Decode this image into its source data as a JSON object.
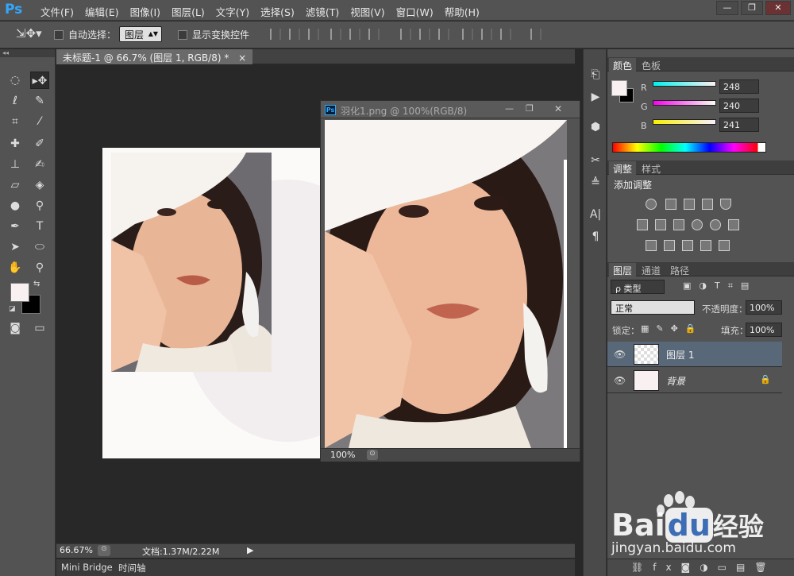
{
  "app": {
    "logo": "Ps"
  },
  "menu": [
    "文件(F)",
    "编辑(E)",
    "图像(I)",
    "图层(L)",
    "文字(Y)",
    "选择(S)",
    "滤镜(T)",
    "视图(V)",
    "窗口(W)",
    "帮助(H)"
  ],
  "window_controls": {
    "minimize": "—",
    "restore": "❐",
    "close": "✕"
  },
  "options": {
    "tool_icon": "move-tool-icon",
    "auto_select_label": "自动选择：",
    "auto_select_value": "图层",
    "show_transform_label": "显示变换控件"
  },
  "document": {
    "tab_title": "未标题-1 @ 66.7% (图层 1, RGB/8) *",
    "tab_close": "×",
    "zoom": "66.67%",
    "doc_info": "文档:1.37M/2.22M"
  },
  "floating_window": {
    "title": "羽化1.png @ 100%(RGB/8)",
    "zoom": "100%"
  },
  "bottom_tabs": [
    "Mini Bridge",
    "时间轴"
  ],
  "color_panel": {
    "tabs": [
      "颜色",
      "色板"
    ],
    "r_label": "R",
    "r_value": "248",
    "g_label": "G",
    "g_value": "240",
    "b_label": "B",
    "b_value": "241"
  },
  "adjust_panel": {
    "tabs": [
      "调整",
      "样式"
    ],
    "title": "添加调整"
  },
  "layers_panel": {
    "tabs": [
      "图层",
      "通道",
      "路径"
    ],
    "filter_label": "ρ 类型",
    "blend_mode": "正常",
    "opacity_label": "不透明度：",
    "opacity_value": "100%",
    "lock_label": "锁定：",
    "fill_label": "填充：",
    "fill_value": "100%",
    "layers": [
      {
        "name": "图层 1"
      },
      {
        "name": "背景"
      }
    ]
  },
  "watermark": {
    "brand_left": "Bai",
    "brand_mid": "du",
    "brand_cn": "经验",
    "url": "jingyan.baidu.com"
  },
  "colors": {
    "foreground": "#f8f0f1",
    "background": "#000000",
    "accent": "#31a8ff"
  }
}
